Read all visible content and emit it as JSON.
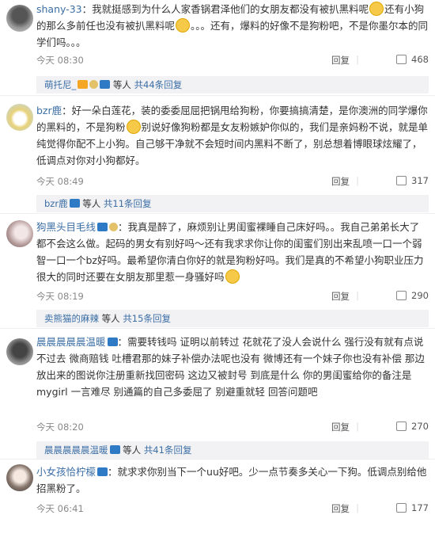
{
  "comments": [
    {
      "user": "shany-33",
      "text_a": "：我就挺感到为什么人家香锅君泽他们的女朋友都没有被扒黑料呢",
      "text_b": "还有小狗的那么多前任也没有被扒黑料呢",
      "text_c": "。。。还有，爆料的好像不是狗粉吧，不是你墨尔本的同学们吗。。。",
      "time": "今天 08:30",
      "reply_label": "回复",
      "likes": "468",
      "sub": {
        "user": "萌托尼_",
        "etc": "等人",
        "total": "共44条回复"
      }
    },
    {
      "user": "bzr鹿",
      "text_a": "：好一朵白莲花，装的委委屈屈把锅甩给狗粉，你要搞搞清楚，是你澳洲的同学爆你的黑料的，不是狗粉",
      "text_b": "别说好像狗粉都是女友粉嫉妒你似的，我们是亲妈粉不说，就是单纯觉得你配不上小狗。自己够干净就不会短时间内黑料不断了，别总想着博眼球炫耀了，低调点对你对小狗都好。",
      "time": "今天 08:49",
      "reply_label": "回复",
      "likes": "317",
      "sub": {
        "user": "bzr鹿",
        "etc": "等人",
        "total": "共11条回复"
      }
    },
    {
      "user": "狗黑头目毛线",
      "text_a": "：我真是醉了，麻烦别让男闺蜜裸睡自己床好吗。。我自己弟弟长大了都不会这么做。起码的男女有别好吗～还有我求求你让你的闺蜜们别出来乱喷一口一个弱智一口一个bz好吗。最希望你清白你好的就是狗粉好吗。我们是真的不希望小狗职业压力很大的同时还要在女朋友那里惹一身骚好吗",
      "time": "今天 08:19",
      "reply_label": "回复",
      "likes": "290",
      "sub": {
        "user": "卖熊猫的麻辣",
        "etc": "等人",
        "total": "共15条回复"
      }
    },
    {
      "user": "晨晨晨晨晨温暖",
      "text_a": "：需要转钱吗 证明以前转过 花就花了没人会说什么 强行没有就有点说不过去 微商赔钱 吐槽君那的妹子补偿办法呢也没有 微博还有一个妹子你也没有补偿 那边放出来的图说你注册重新找回密码 这边又被封号 到底是什么 你的男闺蜜给你的备注是 mygirl 一言难尽 别通篇的自己多委屈了 别避重就轻 回答问题吧",
      "time": "今天 08:20",
      "reply_label": "回复",
      "likes": "270",
      "sub": {
        "user": "晨晨晨晨晨温暖",
        "etc": "等人",
        "total": "共41条回复"
      }
    },
    {
      "user": "小女孩恰柠檬",
      "text_a": "：就求求你别当下一个uu好吧。少一点节奏多关心一下狗。低调点别给他招黑粉了。",
      "time": "今天 06:41",
      "reply_label": "回复",
      "likes": "177"
    }
  ]
}
